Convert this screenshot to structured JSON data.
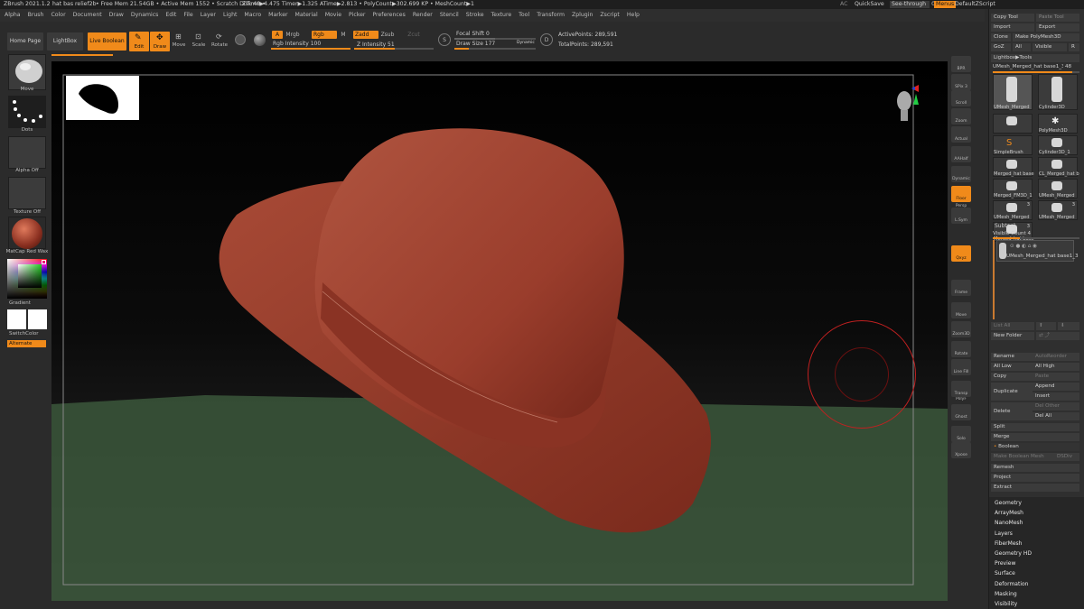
{
  "title": {
    "app": "ZBrush 2021.1.2",
    "doc": "hat bas relief2b",
    "mem": "• Free Mem 21.54GB • Active Mem 1552 • Scratch Disk 49 •",
    "timers": "ZTime▶4.475 Timer▶1.325 ATime▶2.813 • PolyCount▶302.699 KP • MeshCount▶1",
    "ac": "AC",
    "quicksave": "QuickSave",
    "see_through": "See-through",
    "see_through_value": "0",
    "menus": "Menus",
    "default_zscript": "DefaultZScript"
  },
  "menu": [
    "Alpha",
    "Brush",
    "Color",
    "Document",
    "Draw",
    "Dynamics",
    "Edit",
    "File",
    "Layer",
    "Light",
    "Macro",
    "Marker",
    "Material",
    "Movie",
    "Picker",
    "Preferences",
    "Render",
    "Stencil",
    "Stroke",
    "Texture",
    "Tool",
    "Transform",
    "Zplugin",
    "Zscript",
    "Help"
  ],
  "toolbar": {
    "home": "Home Page",
    "lightbox": "LightBox",
    "live_boolean": "Live Boolean",
    "edit": "Edit",
    "draw": "Draw",
    "move": "Move",
    "scale": "Scale",
    "rotate": "Rotate",
    "a": "A",
    "mrgb": "Mrgb",
    "rgb": "Rgb",
    "m": "M",
    "rgb_intensity": "Rgb Intensity 100",
    "zadd": "Zadd",
    "zsub": "Zsub",
    "zcut": "Zcut",
    "z_intensity": "Z Intensity 51",
    "focal_shift": "Focal Shift 0",
    "draw_size": "Draw Size 177",
    "dynamic": "Dynamic",
    "active_points": "ActivePoints: 289,591",
    "total_points": "TotalPoints: 289,591",
    "rgb_intensity_value": 1.0,
    "z_intensity_value": 0.51,
    "draw_size_value": 0.18
  },
  "left": {
    "move": "Move",
    "dots": "Dots",
    "alpha": "Alpha Off",
    "texture": "Texture Off",
    "matcap": "MatCap Red Wax",
    "gradient": "Gradient",
    "switchcolor": "SwitchColor",
    "alternate": "Alternate"
  },
  "rstrip": [
    "BPR",
    "SPix 3",
    "Scroll",
    "Zoom",
    "Actual",
    "AAHalf",
    "Dynamic Persp",
    "Floor",
    "L.Sym",
    "Qxyz",
    "Frame",
    "Move",
    "Zoom3D",
    "Rotate",
    "Line Fill PolyF",
    "Transp",
    "Ghost",
    "Solo",
    "Xpose"
  ],
  "rpanel": {
    "copy_tool": "Copy Tool",
    "paste_tool": "Paste Tool",
    "import": "Import",
    "export": "Export",
    "clone": "Clone",
    "make_polymesh": "Make PolyMesh3D",
    "goz": "GoZ",
    "all": "All",
    "visible": "Visible",
    "r": "R",
    "lightbox_tools": "Lightbox▶Tools",
    "current_tool": "UMesh_Merged_hat base1_3",
    "current_tool_num": "48",
    "tools": [
      {
        "name": "UMesh_Merged",
        "badge": ""
      },
      {
        "name": "Cylinder3D",
        "badge": ""
      },
      {
        "name": "",
        "badge": ""
      },
      {
        "name": "PolyMesh3D",
        "badge": ""
      },
      {
        "name": "SimpleBrush",
        "badge": ""
      },
      {
        "name": "Cylinder3D_1",
        "badge": ""
      },
      {
        "name": "Merged_hat base",
        "badge": ""
      },
      {
        "name": "CL_Merged_hat b",
        "badge": ""
      },
      {
        "name": "Merged_FM3D_1",
        "badge": ""
      },
      {
        "name": "UMesh_Merged",
        "badge": ""
      },
      {
        "name": "UMesh_Merged",
        "badge": "3"
      },
      {
        "name": "UMesh_Merged",
        "badge": "3"
      },
      {
        "name": "Merged_hat base",
        "badge": "3"
      }
    ],
    "subtool": "Subtool",
    "visible_count": "Visible Count 4",
    "subtool_item": "UMesh_Merged_hat base1_3",
    "list_all": "List All",
    "new_folder": "New Folder",
    "rename": "Rename",
    "autoreorder": "AutoReorder",
    "all_low": "All Low",
    "all_high": "All High",
    "copy": "Copy",
    "paste": "Paste",
    "duplicate": "Duplicate",
    "append": "Append",
    "insert": "Insert",
    "delete": "Delete",
    "del_other": "Del Other",
    "del_all": "Del All",
    "split": "Split",
    "merge": "Merge",
    "boolean": "Boolean",
    "make_boolean_mesh": "Make Boolean Mesh",
    "dsdiv": "DSDiv",
    "remesh": "Remesh",
    "project": "Project",
    "extract": "Extract",
    "sections": [
      "Geometry",
      "ArrayMesh",
      "NanoMesh",
      "Layers",
      "FiberMesh",
      "Geometry HD",
      "Preview",
      "Surface",
      "Deformation",
      "Masking",
      "Visibility"
    ]
  },
  "colors": {
    "accent": "#f08a1a",
    "hat": "#9c3d2a",
    "floor": "#3c5a3c"
  }
}
